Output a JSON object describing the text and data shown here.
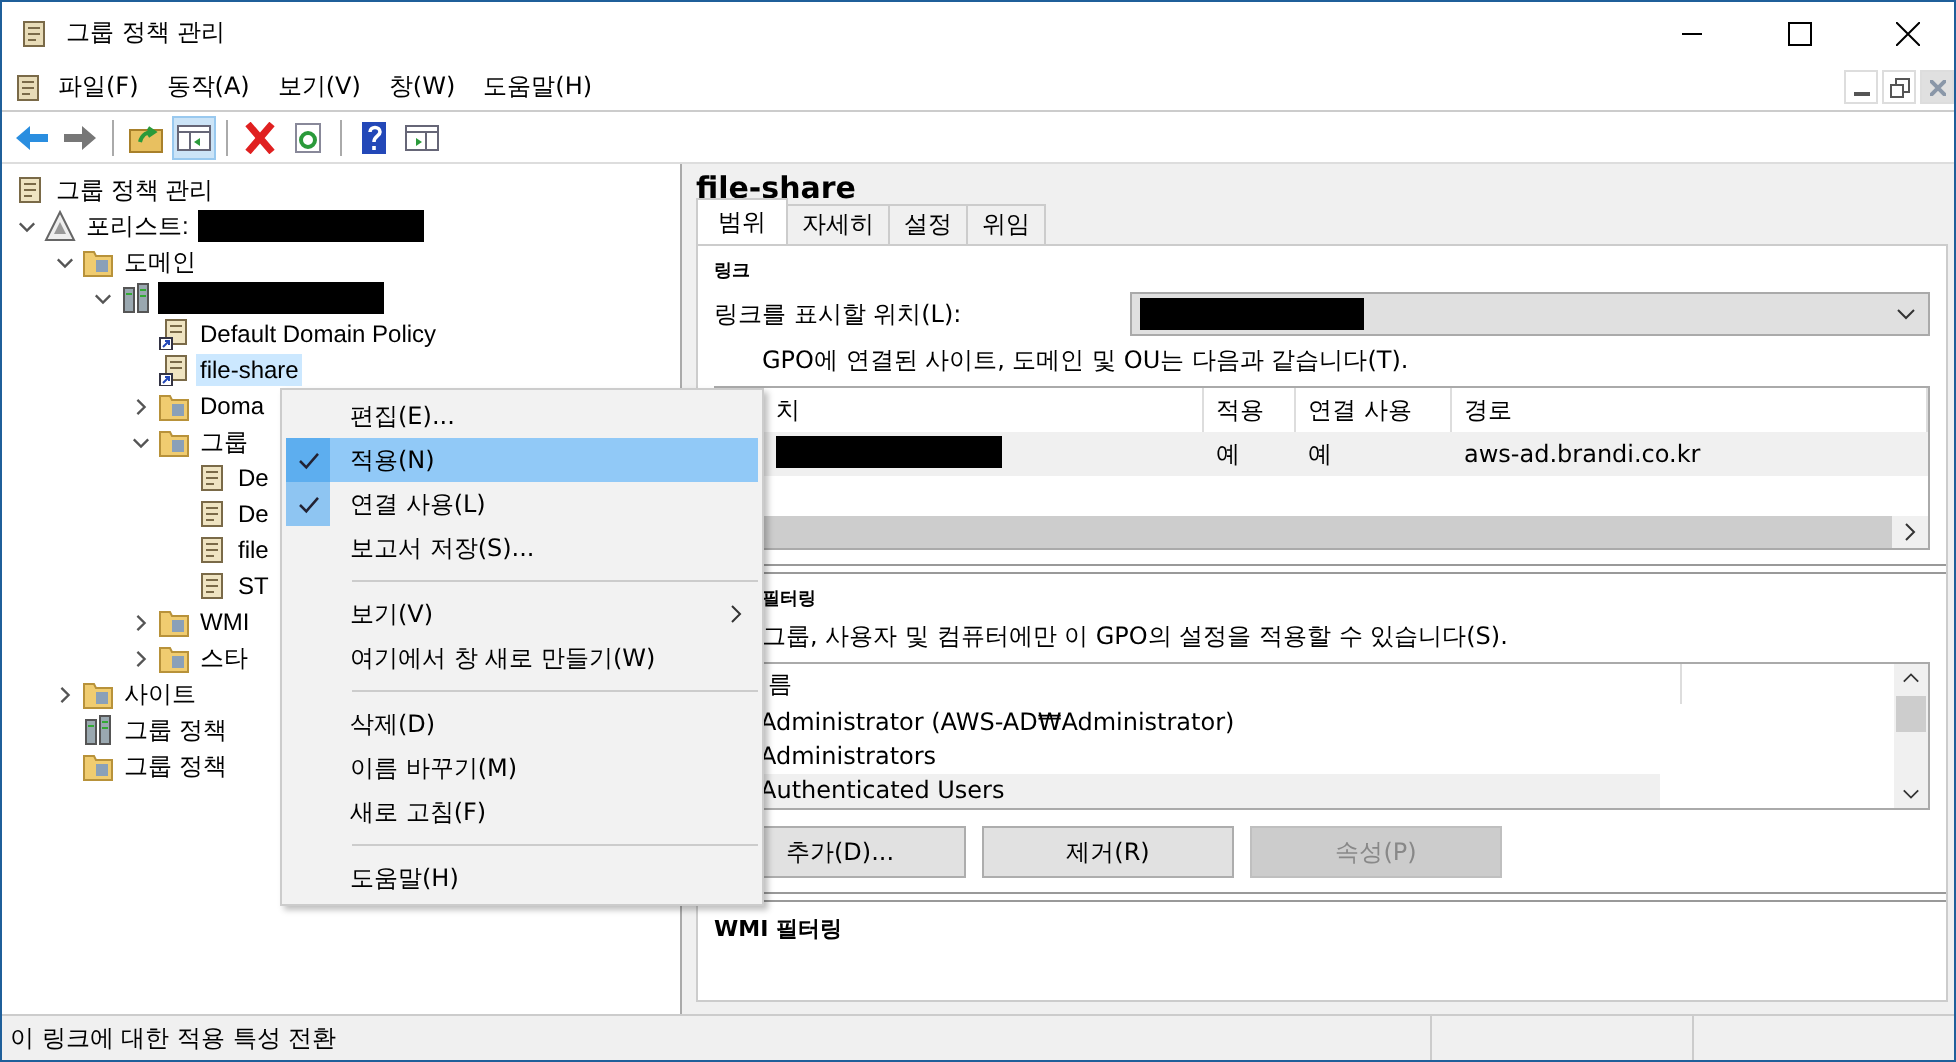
{
  "window": {
    "title": "그룹 정책 관리"
  },
  "menu": [
    {
      "label": "파일(F)"
    },
    {
      "label": "동작(A)"
    },
    {
      "label": "보기(V)"
    },
    {
      "label": "창(W)"
    },
    {
      "label": "도움말(H)"
    }
  ],
  "toolbar": [
    {
      "kind": "back"
    },
    {
      "kind": "forward"
    },
    {
      "kind": "sep"
    },
    {
      "kind": "up",
      "pressed": false
    },
    {
      "kind": "tree",
      "pressed": true
    },
    {
      "kind": "sep"
    },
    {
      "kind": "delete"
    },
    {
      "kind": "refresh"
    },
    {
      "kind": "sep"
    },
    {
      "kind": "help"
    },
    {
      "kind": "panel"
    }
  ],
  "tree": [
    {
      "label": "그룹 정책 관리",
      "kind": "scroll",
      "selected": false,
      "children": [
        {
          "label": "포리스트:",
          "kind": "forest",
          "expanded": true,
          "redacted": true,
          "selected": false,
          "children": [
            {
              "label": "도메인",
              "kind": "folder",
              "expanded": true,
              "selected": false,
              "children": [
                {
                  "kind": "server",
                  "expanded": true,
                  "redacted": true,
                  "children": [
                    {
                      "label": "Default Domain Policy",
                      "kind": "link",
                      "selected": false
                    },
                    {
                      "label": "file-share",
                      "kind": "link",
                      "selected": true
                    },
                    {
                      "label": "Doma",
                      "kind": "folder",
                      "expanded": false,
                      "selected": false
                    },
                    {
                      "label": "그룹",
                      "kind": "folder",
                      "expanded": true,
                      "selected": false,
                      "children": [
                        {
                          "label": "De",
                          "kind": "scroll",
                          "selected": false
                        },
                        {
                          "label": "De",
                          "kind": "scroll",
                          "selected": false
                        },
                        {
                          "label": "file",
                          "kind": "scroll",
                          "selected": false
                        },
                        {
                          "label": "ST",
                          "kind": "scroll",
                          "selected": false
                        }
                      ]
                    },
                    {
                      "label": "WMI",
                      "kind": "folder",
                      "expanded": false,
                      "selected": false
                    },
                    {
                      "label": "스타",
                      "kind": "folder",
                      "expanded": false,
                      "selected": false
                    }
                  ]
                }
              ]
            },
            {
              "label": "사이트",
              "kind": "folder",
              "expanded": false,
              "selected": false
            },
            {
              "label": "그룹 정책",
              "kind": "server",
              "selected": false
            },
            {
              "label": "그룹 정책",
              "kind": "folder",
              "selected": false
            }
          ]
        }
      ]
    }
  ],
  "context_menu": [
    {
      "kind": "item",
      "label": "편집(E)...",
      "checked": false,
      "selected": false
    },
    {
      "kind": "item",
      "label": "적용(N)",
      "checked": true,
      "selected": true
    },
    {
      "kind": "item",
      "label": "연결 사용(L)",
      "checked": true,
      "selected": false
    },
    {
      "kind": "item",
      "label": "보고서 저장(S)...",
      "checked": false,
      "selected": false
    },
    {
      "kind": "sep"
    },
    {
      "kind": "item",
      "label": "보기(V)",
      "checked": false,
      "selected": false,
      "submenu": true
    },
    {
      "kind": "item",
      "label": "여기에서 창 새로 만들기(W)",
      "checked": false,
      "selected": false
    },
    {
      "kind": "sep"
    },
    {
      "kind": "item",
      "label": "삭제(D)",
      "checked": false,
      "selected": false
    },
    {
      "kind": "item",
      "label": "이름 바꾸기(M)",
      "checked": false,
      "selected": false
    },
    {
      "kind": "item",
      "label": "새로 고침(F)",
      "checked": false,
      "selected": false
    },
    {
      "kind": "sep"
    },
    {
      "kind": "item",
      "label": "도움말(H)",
      "checked": false,
      "selected": false
    }
  ],
  "detail": {
    "title": "file-share",
    "tabs": [
      {
        "label": "범위",
        "selected": true
      },
      {
        "label": "자세히",
        "selected": false
      },
      {
        "label": "설정",
        "selected": false
      },
      {
        "label": "위임",
        "selected": false
      }
    ],
    "links": {
      "heading": "링크",
      "location_label": "링크를 표시할 위치(L):",
      "note": "GPO에 연결된 사이트, 도메인 및 OU는 다음과 같습니다(T).",
      "columns": [
        "치",
        "적용",
        "연결 사용",
        "경로"
      ],
      "rows": [
        {
          "redacted": true,
          "applied": "예",
          "enabled": "예",
          "path": "aws-ad.brandi.co.kr"
        }
      ]
    },
    "security": {
      "heading": "필터링",
      "note": "그룹, 사용자 및 컴퓨터에만 이 GPO의 설정을 적용할 수 있습니다(S).",
      "column": "름",
      "rows": [
        {
          "label": "Administrator (AWS-AD₩Administrator)",
          "selected": false
        },
        {
          "label": "Administrators",
          "selected": false
        },
        {
          "label": "Authenticated Users",
          "selected": true
        }
      ],
      "buttons": [
        {
          "label": "추가(D)...",
          "disabled": false
        },
        {
          "label": "제거(R)",
          "disabled": false
        },
        {
          "label": "속성(P)",
          "disabled": true
        }
      ]
    },
    "wmi": {
      "heading": "WMI 필터링"
    }
  },
  "status_bar": "이 링크에 대한 적용 특성 전환"
}
